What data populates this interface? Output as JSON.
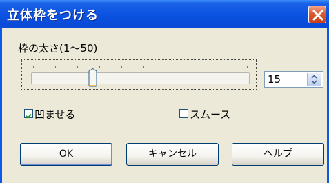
{
  "window": {
    "title": "立体枠をつける",
    "close_label": "×"
  },
  "slider": {
    "label": "枠の太さ(1～50)",
    "min": 1,
    "max": 50,
    "value": 15
  },
  "spin": {
    "value": "15"
  },
  "options": {
    "recess": {
      "label": "凹ませる",
      "checked": true
    },
    "smooth": {
      "label": "スムース",
      "checked": false
    }
  },
  "buttons": {
    "ok": "OK",
    "cancel": "キャンセル",
    "help": "ヘルプ"
  },
  "colors": {
    "titlebar": "#0a52e0",
    "close": "#e0582e",
    "face": "#ece9d8"
  }
}
